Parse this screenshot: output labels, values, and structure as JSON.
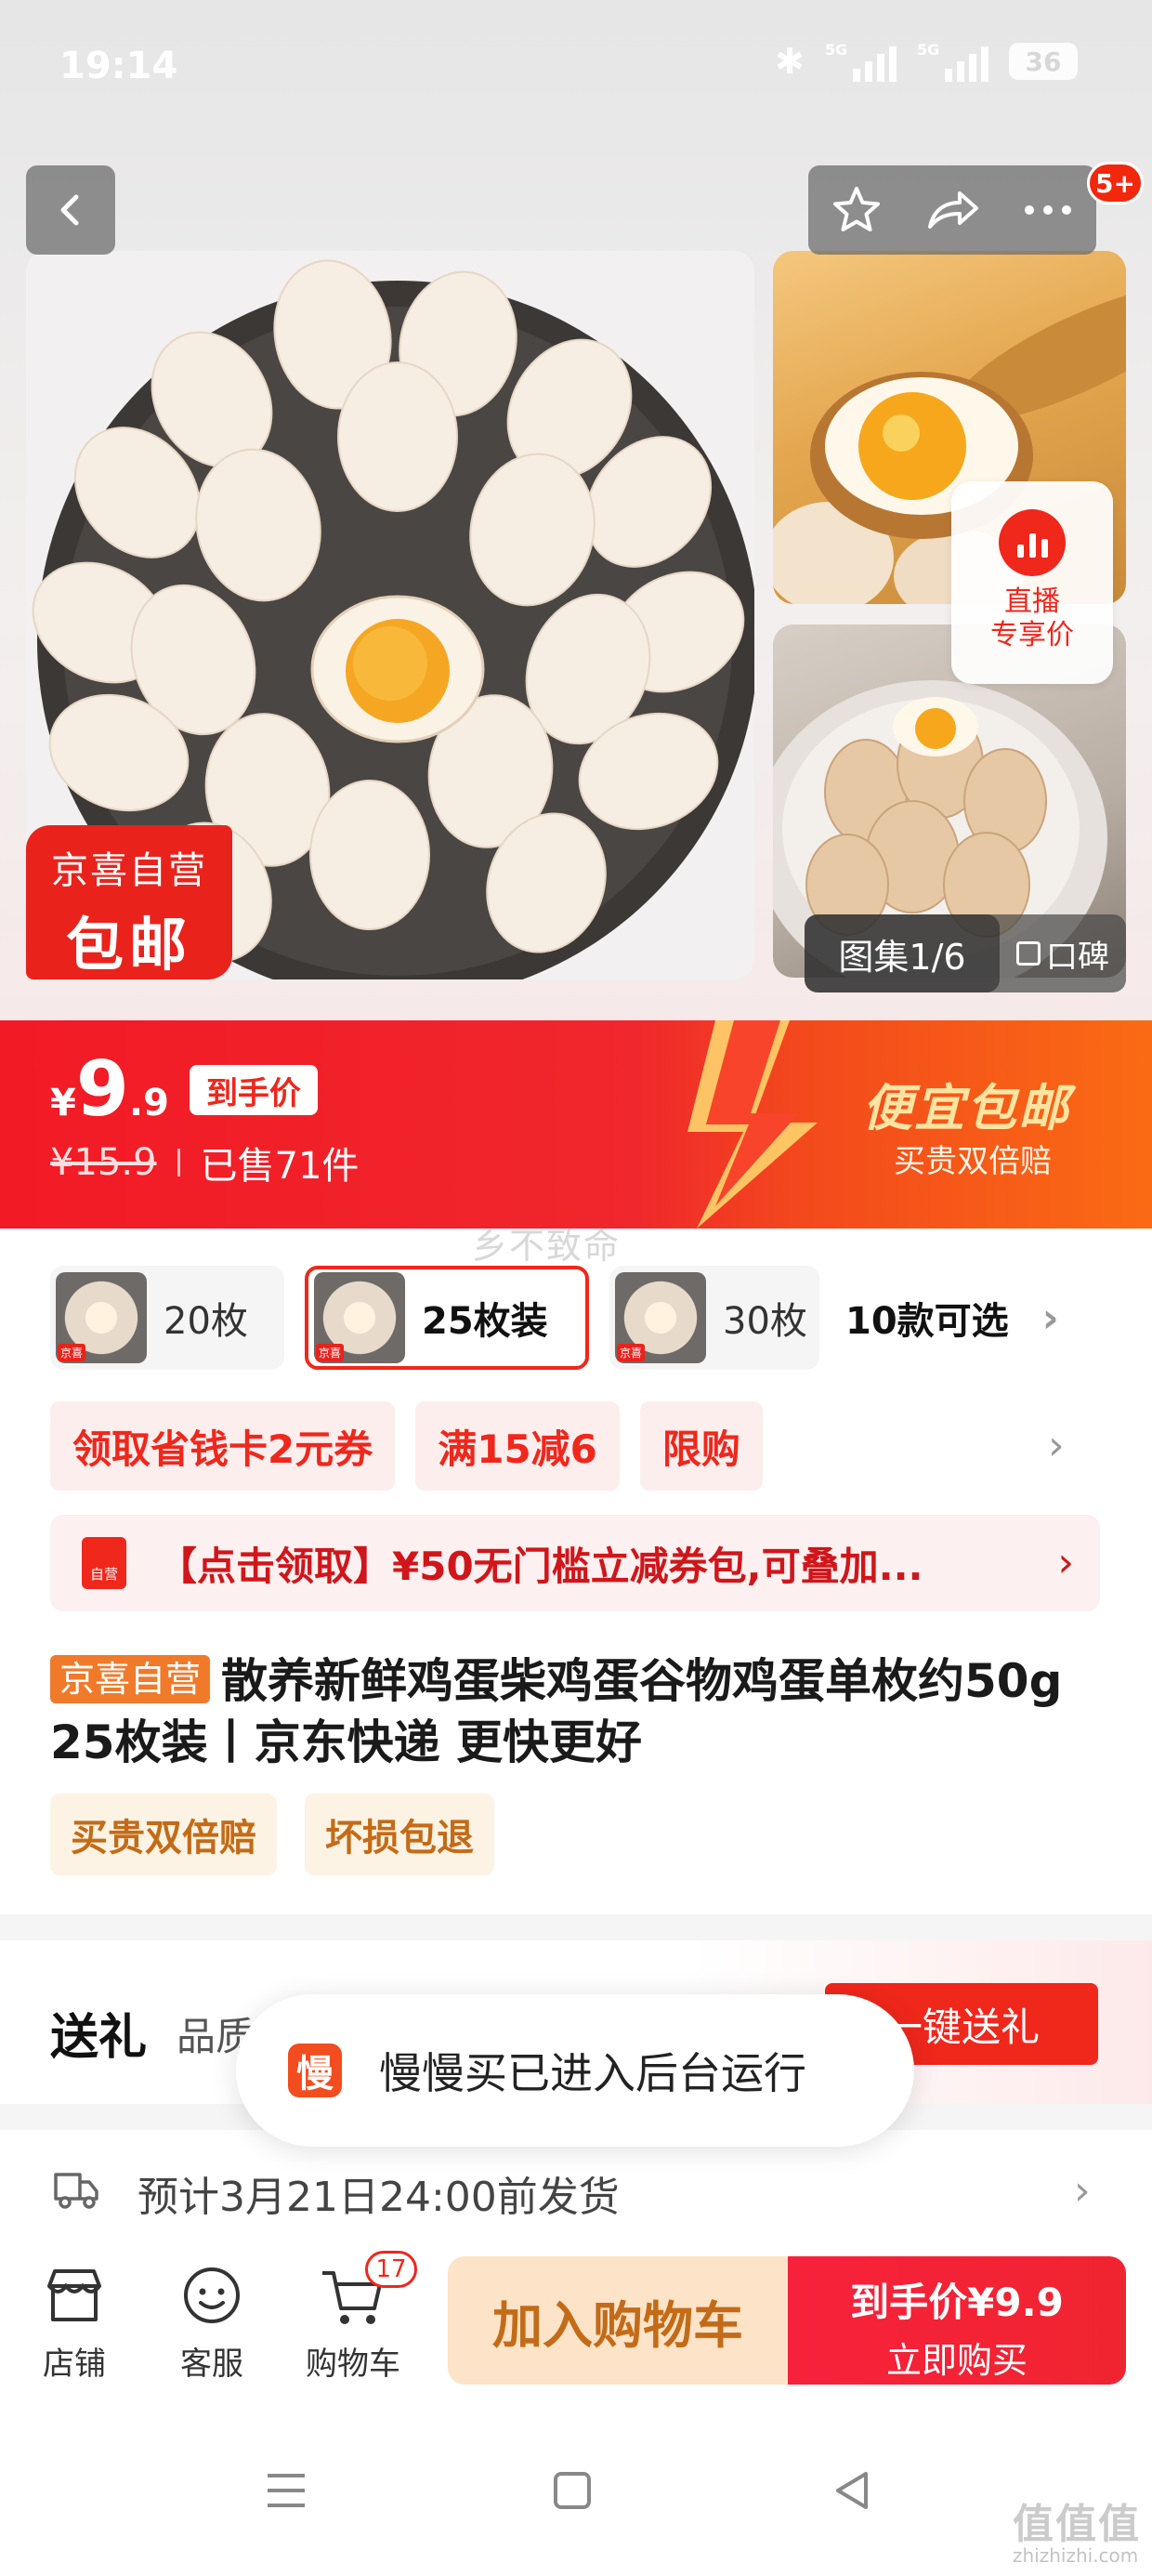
{
  "status_bar": {
    "time": "19:14",
    "battery": "36",
    "network_1": "5G",
    "network_2": "5G"
  },
  "header": {
    "cart_badge": "5+"
  },
  "gallery": {
    "promo_badge_line1": "京喜自营",
    "promo_badge_line2": "包邮",
    "live_label_line1": "直播",
    "live_label_line2": "专享价",
    "album_counter": "图集1/6",
    "review_label": "口碑"
  },
  "price": {
    "currency": "¥",
    "integer": "9",
    "decimal": ".9",
    "price_tag": "到手价",
    "original": "¥15.9",
    "sold": "已售71件",
    "promo_title": "便宜包邮",
    "promo_sub": "买贵双倍赔"
  },
  "watermark": "乡不致命",
  "variants": {
    "items": [
      {
        "label": "20枚",
        "selected": false
      },
      {
        "label": "25枚装",
        "selected": true
      },
      {
        "label": "30枚",
        "selected": false
      }
    ],
    "more": "10款可选",
    "thumb_mark": "京喜"
  },
  "coupons": [
    "领取省钱卡2元券",
    "满15减6",
    "限购"
  ],
  "voucher": {
    "icon_text": "自营",
    "text": "【点击领取】¥50无门槛立减券包,可叠加..."
  },
  "product": {
    "self_operated": "京喜自营",
    "title": "散养新鲜鸡蛋柴鸡蛋谷物鸡蛋单枚约50g 25枚装丨京东快递 更快更好",
    "service_tags": [
      "买贵双倍赔",
      "坏损包退"
    ]
  },
  "gift": {
    "title": "送礼",
    "subtitle": "品质",
    "button": "一键送礼"
  },
  "toast": {
    "icon_text": "慢",
    "text": "慢慢买已进入后台运行"
  },
  "shipping": {
    "text": "预计3月21日24:00前发货"
  },
  "action_bar": {
    "shop": "店铺",
    "service": "客服",
    "cart": "购物车",
    "cart_count": "17",
    "add_to_cart": "加入购物车",
    "buy_line1": "到手价¥9.9",
    "buy_line2": "立即购买"
  },
  "site_mark": {
    "logo": "值值值",
    "url": "zhizhizhi.com"
  },
  "colors": {
    "brand_red": "#f0271b",
    "accent_orange": "#f07a2a",
    "gold": "#c46b17"
  }
}
